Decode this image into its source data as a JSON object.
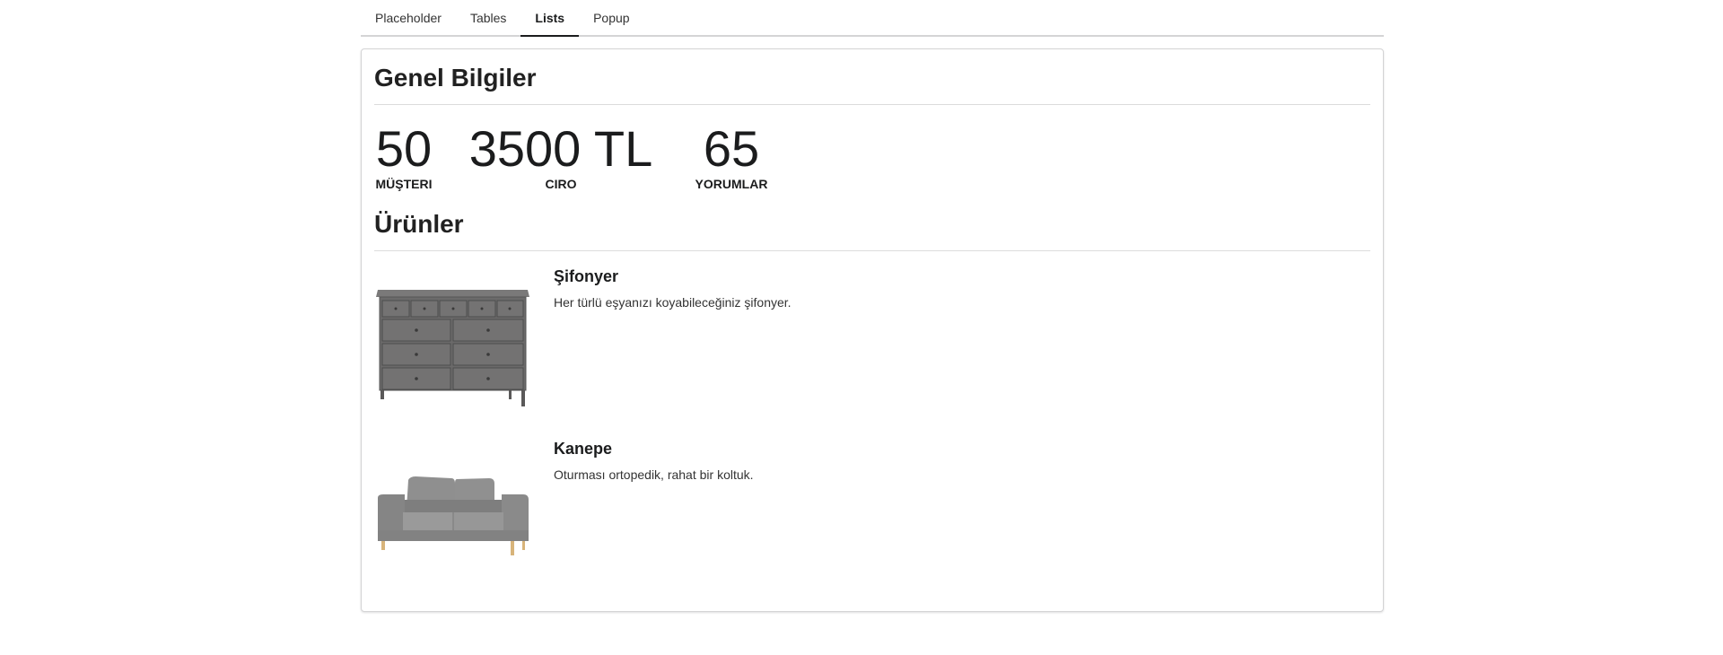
{
  "tabs": [
    {
      "label": "Placeholder",
      "active": false
    },
    {
      "label": "Tables",
      "active": false
    },
    {
      "label": "Lists",
      "active": true
    },
    {
      "label": "Popup",
      "active": false
    }
  ],
  "general": {
    "title": "Genel Bilgiler",
    "stats": [
      {
        "value": "50",
        "label": "MÜŞTERI"
      },
      {
        "value": "3500 TL",
        "label": "CIRO"
      },
      {
        "value": "65",
        "label": "YORUMLAR"
      }
    ]
  },
  "products": {
    "title": "Ürünler",
    "items": [
      {
        "title": "Şifonyer",
        "description": "Her türlü eşyanızı koyabileceğiniz şifonyer.",
        "image_icon": "dresser-icon"
      },
      {
        "title": "Kanepe",
        "description": "Oturması ortopedik, rahat bir koltuk.",
        "image_icon": "sofa-icon"
      }
    ]
  },
  "colors": {
    "text": "#212121",
    "border": "#d4d4d5",
    "furniture_gray": "#6b6a6a",
    "sofa_gray": "#8c8c8c",
    "wood_leg": "#d8b47a"
  }
}
